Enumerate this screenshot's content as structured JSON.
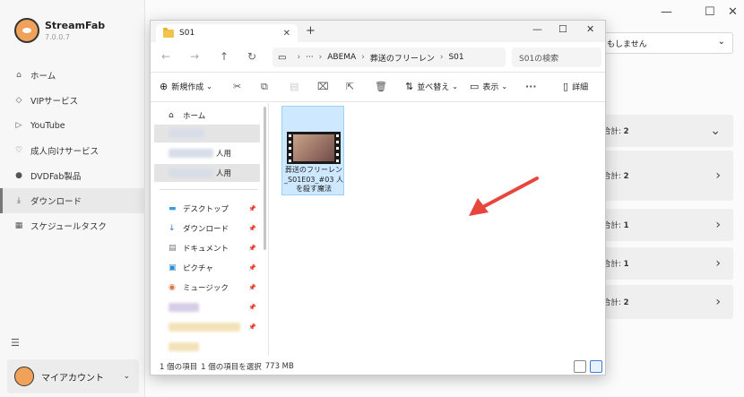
{
  "app": {
    "name": "StreamFab",
    "version": "7.0.0.7"
  },
  "sidebar": {
    "items": [
      {
        "label": "ホーム",
        "icon": "home-icon"
      },
      {
        "label": "VIPサービス",
        "icon": "vip-icon"
      },
      {
        "label": "YouTube",
        "icon": "youtube-icon"
      },
      {
        "label": "成人向けサービス",
        "icon": "heart-icon"
      },
      {
        "label": "DVDFab製品",
        "icon": "dvdfab-icon"
      },
      {
        "label": "ダウンロード",
        "icon": "download-icon",
        "active": true
      },
      {
        "label": "スケジュールタスク",
        "icon": "calendar-icon"
      }
    ],
    "account_label": "マイアカウント"
  },
  "main": {
    "dropdown_value": "もしません",
    "rows": [
      {
        "label": "合計:",
        "count": "2"
      },
      {
        "label": "合計:",
        "count": "2"
      },
      {
        "label": "合計:",
        "count": "1"
      },
      {
        "label": "合計:",
        "count": "1"
      },
      {
        "label": "合計:",
        "count": "2"
      }
    ]
  },
  "explorer": {
    "tab_title": "S01",
    "breadcrumb": [
      "ABEMA",
      "葬送のフリーレン",
      "S01"
    ],
    "search_placeholder": "S01の検索",
    "toolbar": {
      "new_label": "新規作成",
      "sort_label": "並べ替え",
      "view_label": "表示",
      "details_label": "詳細"
    },
    "nav": {
      "home": "ホーム",
      "blurred_item_suffix": "人用",
      "quick_access": [
        {
          "label": "デスクトップ",
          "icon": "desktop-icon"
        },
        {
          "label": "ダウンロード",
          "icon": "download-icon"
        },
        {
          "label": "ドキュメント",
          "icon": "document-icon"
        },
        {
          "label": "ピクチャ",
          "icon": "picture-icon"
        },
        {
          "label": "ミュージック",
          "icon": "music-icon"
        }
      ]
    },
    "file": {
      "name": "葬送のフリーレン_S01E03_#03 人を殺す魔法"
    },
    "status": {
      "count": "1 個の項目",
      "selected": "1 個の項目を選択",
      "size": "773 MB"
    }
  },
  "colors": {
    "accent": "#3c7dd9",
    "selection": "#cde8ff",
    "arrow": "#e8453c"
  }
}
